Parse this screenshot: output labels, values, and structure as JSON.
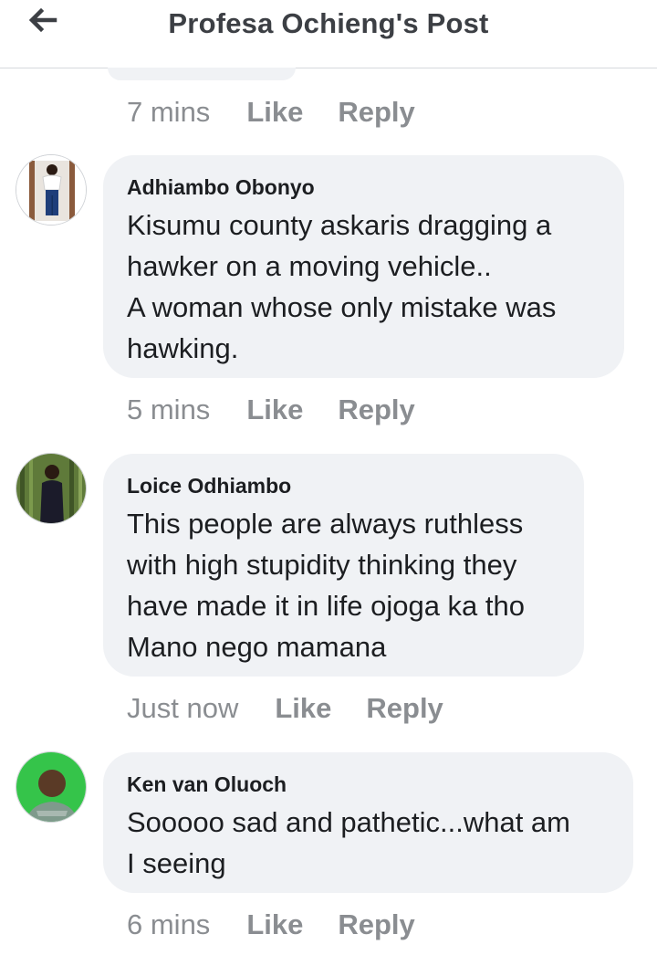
{
  "header": {
    "title": "Profesa Ochieng's Post",
    "back_icon": "arrow-left-icon"
  },
  "previous_comment_meta": {
    "time": "7 mins",
    "like": "Like",
    "reply": "Reply"
  },
  "comments": [
    {
      "author": "Adhiambo Obonyo",
      "text": "Kisumu county askaris dragging a\nhawker on a moving vehicle..\nA woman whose only mistake was\nhawking.",
      "time": "5 mins",
      "like": "Like",
      "reply": "Reply"
    },
    {
      "author": "Loice Odhiambo",
      "text": "This people are always ruthless\nwith high stupidity thinking they\nhave made it in life ojoga ka tho\nMano nego mamana",
      "time": "Just now",
      "like": "Like",
      "reply": "Reply"
    },
    {
      "author": "Ken van Oluoch",
      "text": "Sooooo sad and pathetic...what am\nI seeing",
      "time": "6 mins",
      "like": "Like",
      "reply": "Reply"
    }
  ],
  "colors": {
    "bubble": "#f0f2f5",
    "meta_text": "#8a8d91",
    "title_text": "#3c3f44"
  }
}
